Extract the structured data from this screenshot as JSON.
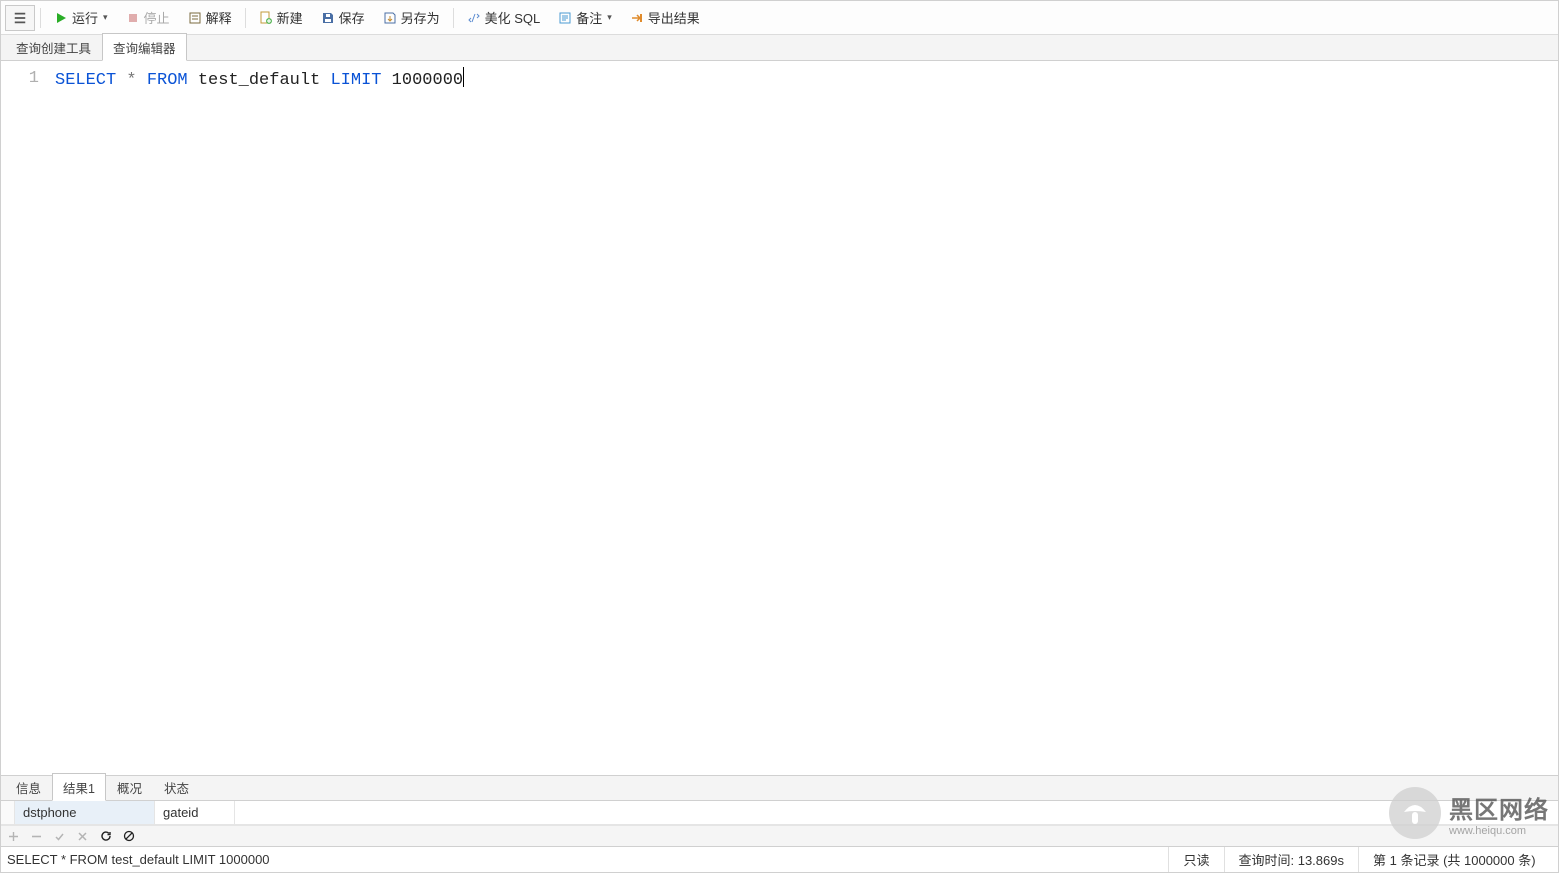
{
  "toolbar": {
    "run": "运行",
    "stop": "停止",
    "explain": "解释",
    "new": "新建",
    "save": "保存",
    "saveAs": "另存为",
    "beautify": "美化 SQL",
    "note": "备注",
    "export": "导出结果"
  },
  "subtabs": {
    "queryBuilder": "查询创建工具",
    "queryEditor": "查询编辑器"
  },
  "editor": {
    "lineNo": "1",
    "kw_select": "SELECT",
    "star": " * ",
    "kw_from": "FROM",
    "table": " test_default ",
    "kw_limit": "LIMIT",
    "limit_val": " 1000000"
  },
  "bottomTabs": {
    "info": "信息",
    "result1": "结果1",
    "summary": "概况",
    "status": "状态"
  },
  "grid": {
    "col1": "dstphone",
    "col2": "gateid"
  },
  "status": {
    "sql": "SELECT * FROM test_default LIMIT 1000000",
    "readonly": "只读",
    "elapsed": "查询时间: 13.869s",
    "records": "第 1 条记录 (共 1000000 条)"
  },
  "watermark": {
    "brand": "黑区网络",
    "sub": "www.heiqu.com"
  }
}
